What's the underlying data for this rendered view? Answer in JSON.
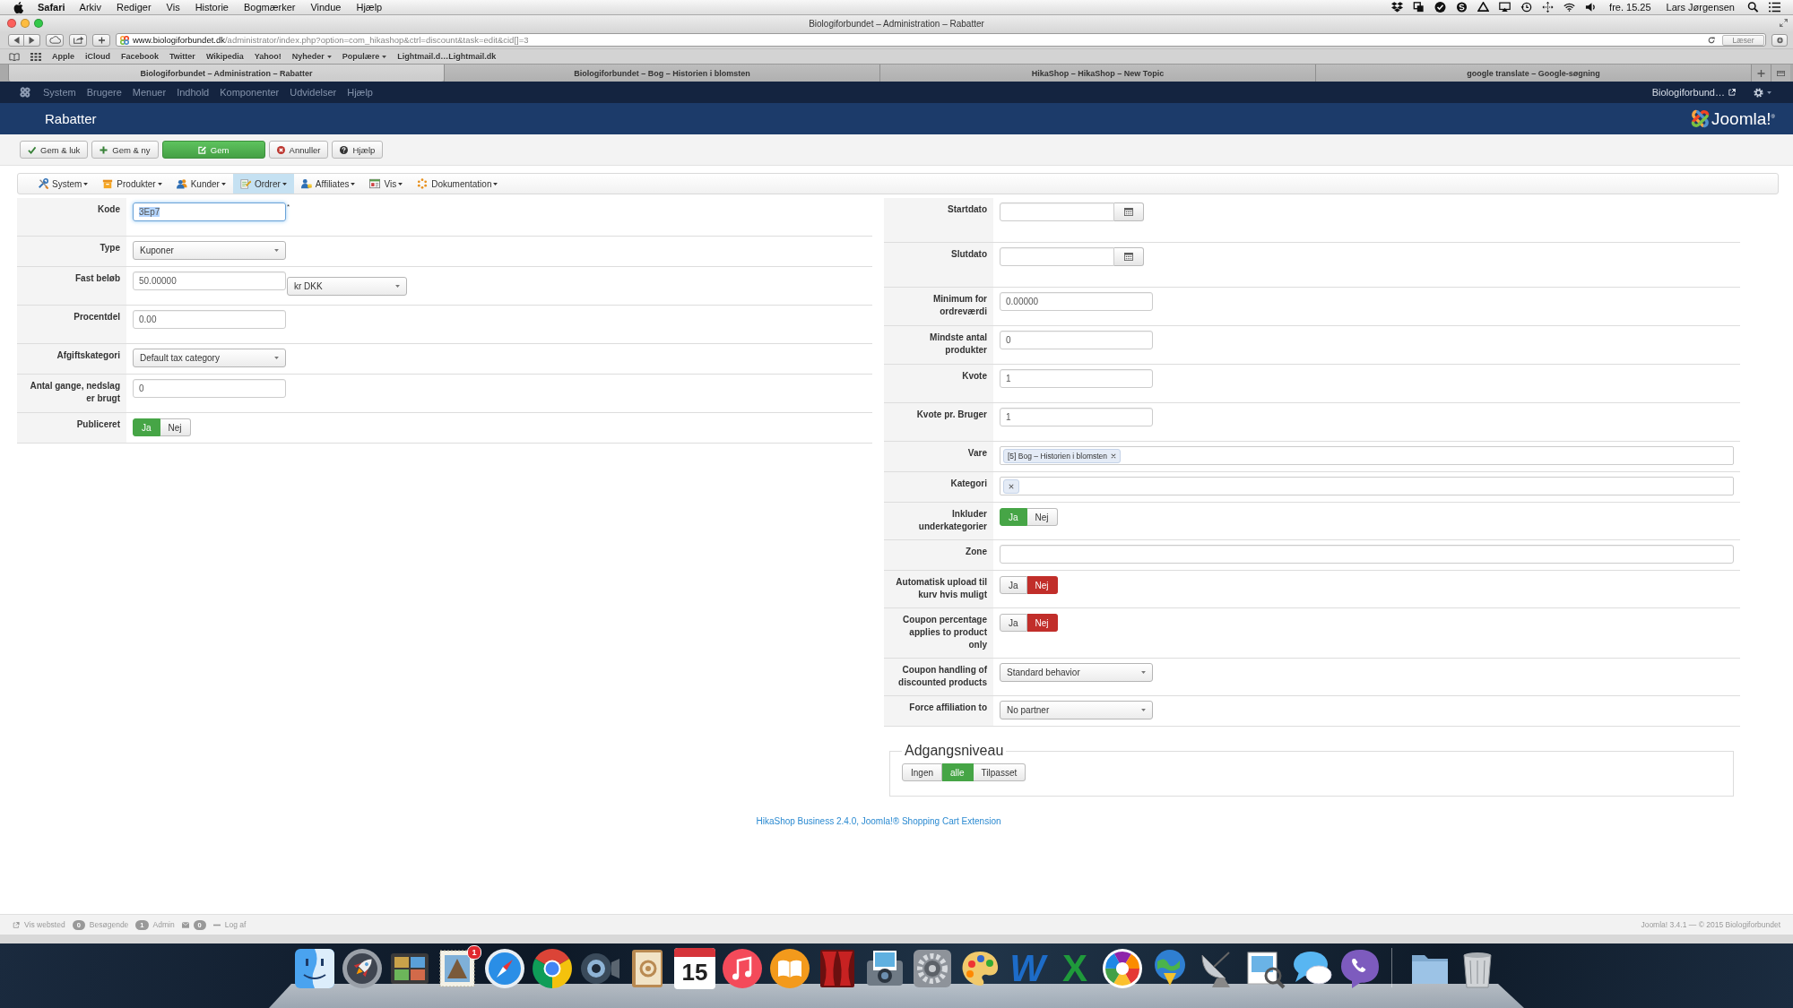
{
  "menu_bar": {
    "app": "Safari",
    "menus": [
      "Arkiv",
      "Rediger",
      "Vis",
      "Historie",
      "Bogmærker",
      "Vindue",
      "Hjælp"
    ],
    "clock": "fre. 15.25",
    "user": "Lars Jørgensen"
  },
  "browser": {
    "title": "Biologiforbundet – Administration – Rabatter",
    "url_host": "www.biologiforbundet.dk",
    "url_path": "/administrator/index.php?option=com_hikashop&ctrl=discount&task=edit&cid[]=3",
    "reader_button": {
      "label": "Læser",
      "disabled": true
    },
    "bookmarks": [
      {
        "label": "Apple",
        "menu": false
      },
      {
        "label": "iCloud",
        "menu": false
      },
      {
        "label": "Facebook",
        "menu": false
      },
      {
        "label": "Twitter",
        "menu": false
      },
      {
        "label": "Wikipedia",
        "menu": false
      },
      {
        "label": "Yahoo!",
        "menu": false
      },
      {
        "label": "Nyheder",
        "menu": true
      },
      {
        "label": "Populære",
        "menu": true
      },
      {
        "label": "Lightmail.d…Lightmail.dk",
        "menu": false
      }
    ],
    "tabs": [
      {
        "title": "Biologiforbundet – Administration – Rabatter",
        "selected": true
      },
      {
        "title": "Biologiforbundet – Bog – Historien i blomsten",
        "selected": false
      },
      {
        "title": "HikaShop – HikaShop – New Topic",
        "selected": false
      },
      {
        "title": "google translate – Google-søgning",
        "selected": false
      }
    ]
  },
  "admin_nav": {
    "items": [
      "System",
      "Brugere",
      "Menuer",
      "Indhold",
      "Komponenter",
      "Udvidelser",
      "Hjælp"
    ],
    "site_link": "Biologiforbund…"
  },
  "page_header": {
    "title": "Rabatter",
    "logo_text": "Joomla!$^{®}$"
  },
  "toolbar": [
    {
      "label": "Gem & luk",
      "kind": "save_close",
      "primary": false
    },
    {
      "label": "Gem & ny",
      "kind": "save_new",
      "primary": false
    },
    {
      "label": "Gem",
      "kind": "save",
      "primary": true
    },
    {
      "label": "Annuller",
      "kind": "cancel",
      "primary": false
    },
    {
      "label": "Hjælp",
      "kind": "help",
      "primary": false
    }
  ],
  "submenu": [
    {
      "label": "System",
      "kind": "system",
      "selected": false
    },
    {
      "label": "Produkter",
      "kind": "products",
      "selected": false
    },
    {
      "label": "Kunder",
      "kind": "customers",
      "selected": false
    },
    {
      "label": "Ordrer",
      "kind": "orders",
      "selected": true
    },
    {
      "label": "Affiliates",
      "kind": "affiliates",
      "selected": false
    },
    {
      "label": "Vis",
      "kind": "display",
      "selected": false
    },
    {
      "label": "Dokumentation",
      "kind": "docs",
      "selected": false
    }
  ],
  "form_left": {
    "rows": [
      {
        "label": "Kode",
        "kind": "text",
        "value": "3Ep7",
        "focused": true,
        "required_mark": "*"
      },
      {
        "label": "Type",
        "kind": "select",
        "value": "Kuponer"
      },
      {
        "label": "Fast beløb",
        "kind": "text_select",
        "value": "50.00000",
        "select_value": "kr DKK"
      },
      {
        "label": "Procentdel",
        "kind": "text",
        "value": "0.00",
        "focused": false
      },
      {
        "label": "Afgiftskategori",
        "kind": "select",
        "value": "Default tax category"
      },
      {
        "label": "Antal gange, nedslag er brugt",
        "kind": "text",
        "value": "0",
        "focused": false
      },
      {
        "label": "Publiceret",
        "kind": "toggle",
        "color": "#46a546",
        "options": [
          {
            "label": "Ja",
            "selected": true
          },
          {
            "label": "Nej",
            "selected": false
          }
        ]
      }
    ]
  },
  "form_right": {
    "rows": [
      {
        "label": "Startdato",
        "kind": "date"
      },
      {
        "label": "Slutdato",
        "kind": "date"
      },
      {
        "label": "Minimum for ordreværdi",
        "kind": "text",
        "value": "0.00000",
        "focused": false
      },
      {
        "label": "Mindste antal produkter",
        "kind": "text",
        "value": "0",
        "focused": false
      },
      {
        "label": "Kvote",
        "kind": "text",
        "value": "1",
        "focused": false
      },
      {
        "label": "Kvote pr. Bruger",
        "kind": "text",
        "value": "1",
        "focused": false
      },
      {
        "label": "Vare",
        "kind": "tags",
        "tags": [
          {
            "kind": "labeled",
            "label": "[5] Bog – Historien i blomsten"
          }
        ]
      },
      {
        "label": "Kategori",
        "kind": "tags",
        "tags": [
          {
            "kind": "blank"
          }
        ]
      },
      {
        "label": "Inkluder underkategorier",
        "kind": "toggle",
        "color": "#46a546",
        "options": [
          {
            "label": "Ja",
            "selected": true
          },
          {
            "label": "Nej",
            "selected": false
          }
        ]
      },
      {
        "label": "Zone",
        "kind": "wide_text"
      },
      {
        "label": "Automatisk upload til kurv hvis muligt",
        "kind": "toggle",
        "color": "#c12e2a",
        "options": [
          {
            "label": "Ja",
            "selected": false
          },
          {
            "label": "Nej",
            "selected": true
          }
        ]
      },
      {
        "label": "Coupon percentage applies to product only",
        "kind": "toggle",
        "color": "#c12e2a",
        "options": [
          {
            "label": "Ja",
            "selected": false
          },
          {
            "label": "Nej",
            "selected": true
          }
        ]
      },
      {
        "label": "Coupon handling of discounted products",
        "kind": "select",
        "value": "Standard behavior"
      },
      {
        "label": "Force affiliation to",
        "kind": "select",
        "value": "No partner"
      }
    ],
    "access_fieldset": {
      "legend": "Adgangsniveau",
      "color": "#46a546",
      "options": [
        {
          "label": "Ingen",
          "selected": false
        },
        {
          "label": "alle",
          "selected": true
        },
        {
          "label": "Tilpasset",
          "selected": false
        }
      ]
    }
  },
  "footer_link": "HikaShop Business 2.4.0, Joomla!® Shopping Cart Extension",
  "status_bar": {
    "items": [
      {
        "kind": "link",
        "label": "Vis websted"
      },
      {
        "kind": "count",
        "count": "0",
        "label": "Besøgende"
      },
      {
        "kind": "count",
        "count": "1",
        "label": "Admin"
      },
      {
        "kind": "mail",
        "count": "0"
      },
      {
        "kind": "logout",
        "label": "Log af"
      }
    ],
    "copyright": "Joomla! 3.4.1 — © 2015 Biologiforbundet"
  },
  "dock": {
    "badge": "1",
    "calendar_day": "15",
    "letter_icons": [
      "W",
      "X"
    ]
  }
}
